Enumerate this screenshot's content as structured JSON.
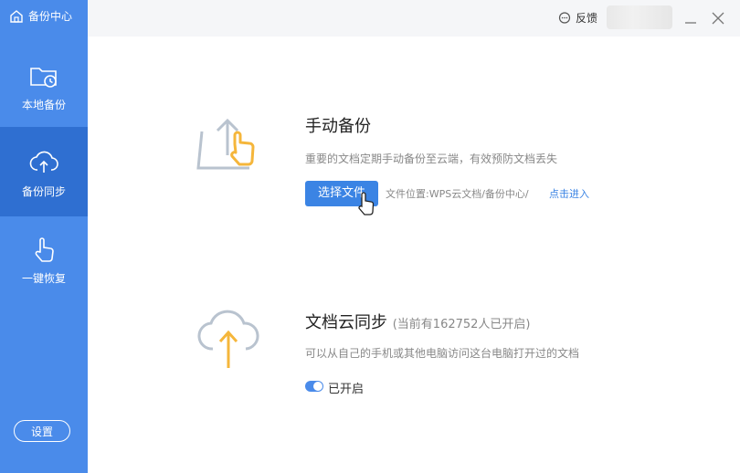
{
  "app": {
    "title": "备份中心"
  },
  "sidebar": {
    "items": [
      {
        "label": "本地备份",
        "icon": "folder-clock-icon"
      },
      {
        "label": "备份同步",
        "icon": "cloud-upload-icon",
        "active": true
      },
      {
        "label": "一键恢复",
        "icon": "hand-pointer-icon"
      }
    ],
    "settings_label": "设置"
  },
  "topbar": {
    "feedback_label": "反馈"
  },
  "manual_backup": {
    "title": "手动备份",
    "description": "重要的文档定期手动备份至云端，有效预防文档丢失",
    "button_label": "选择文件",
    "path_text": "文件位置:WPS云文档/备份中心/",
    "link_label": "点击进入"
  },
  "cloud_sync": {
    "title": "文档云同步",
    "subtitle": "(当前有162752人已开启)",
    "description": "可以从自己的手机或其他电脑访问这台电脑打开过的文档",
    "toggle_label": "已开启",
    "toggle_on": true
  },
  "colors": {
    "sidebar": "#4a8bea",
    "sidebar_active": "#2f6fd1",
    "accent": "#3b84e4",
    "illustration_orange": "#f5b63b"
  }
}
